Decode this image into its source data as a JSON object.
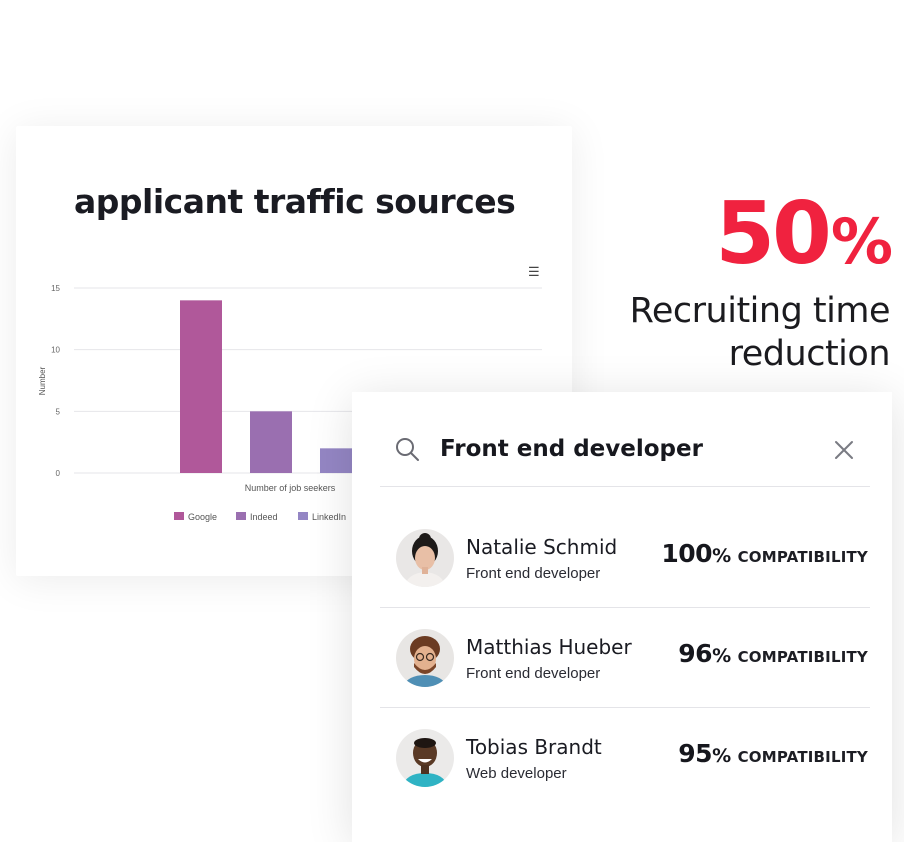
{
  "colors": {
    "accent": "#f0223f",
    "google": "#b0589a",
    "indeed": "#9a6fb0",
    "linkedin": "#9486c4"
  },
  "chart": {
    "title": "applicant traffic sources",
    "menu_icon": "hamburger-menu-icon"
  },
  "chart_data": {
    "type": "bar",
    "title": "applicant traffic sources",
    "xlabel": "Number of job seekers",
    "ylabel": "Number",
    "ylim": [
      0,
      15
    ],
    "yticks": [
      "0",
      "5",
      "10",
      "15"
    ],
    "grid": true,
    "legend_position": "bottom",
    "series": [
      {
        "name": "Google",
        "values": [
          14
        ],
        "color": "#b0589a"
      },
      {
        "name": "Indeed",
        "values": [
          5
        ],
        "color": "#9a6fb0"
      },
      {
        "name": "LinkedIn",
        "values": [
          2
        ],
        "color": "#9486c4"
      }
    ]
  },
  "stat": {
    "value": "50",
    "unit": "%",
    "label_line1": "Recruiting time",
    "label_line2": "reduction"
  },
  "search": {
    "query": "Front end developer",
    "icon": "search-icon",
    "close_icon": "close-icon"
  },
  "candidates": [
    {
      "name": "Natalie Schmid",
      "role": "Front end developer",
      "score": "100",
      "unit": "%",
      "label": "COMPATIBILITY"
    },
    {
      "name": "Matthias Hueber",
      "role": "Front end developer",
      "score": "96",
      "unit": "%",
      "label": "COMPATIBILITY"
    },
    {
      "name": "Tobias Brandt",
      "role": "Web developer",
      "score": "95",
      "unit": "%",
      "label": "COMPATIBILITY"
    }
  ]
}
